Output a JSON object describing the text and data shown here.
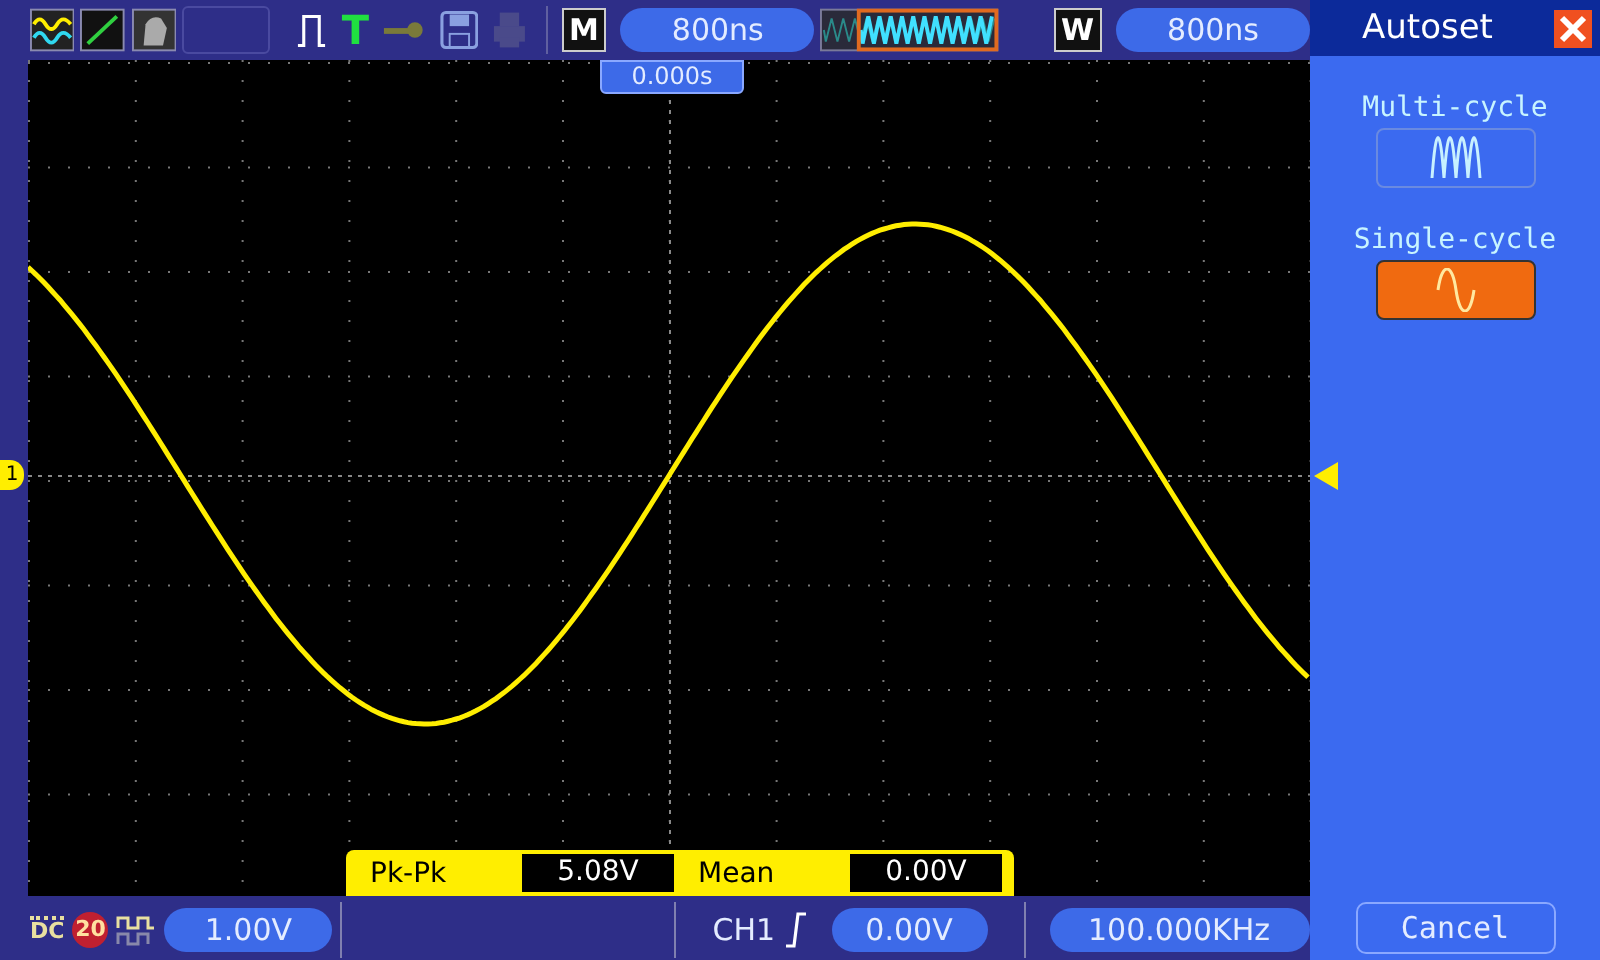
{
  "top_bar": {
    "mode_badge": "M",
    "timebase": "800ns",
    "window_badge": "W",
    "window_timebase": "800ns",
    "trigger_letter": "T"
  },
  "screen": {
    "trigger_position": "0.000s",
    "channel_marker": "1",
    "measurements": [
      {
        "label": "Pk-Pk",
        "value": "5.08V"
      },
      {
        "label": "Mean",
        "value": "0.00V"
      }
    ]
  },
  "autoset_panel": {
    "title": "Autoset",
    "options": [
      {
        "label": "Multi-cycle",
        "kind": "multi",
        "selected": false
      },
      {
        "label": "Single-cycle",
        "kind": "single",
        "selected": true
      }
    ],
    "cancel": "Cancel"
  },
  "bottom_bar": {
    "coupling": "DC",
    "bandwidth_limit": "20",
    "volts_per_div": "1.00V",
    "trigger_source": "CH1",
    "trigger_level": "0.00V",
    "frequency": "100.000KHz"
  }
}
